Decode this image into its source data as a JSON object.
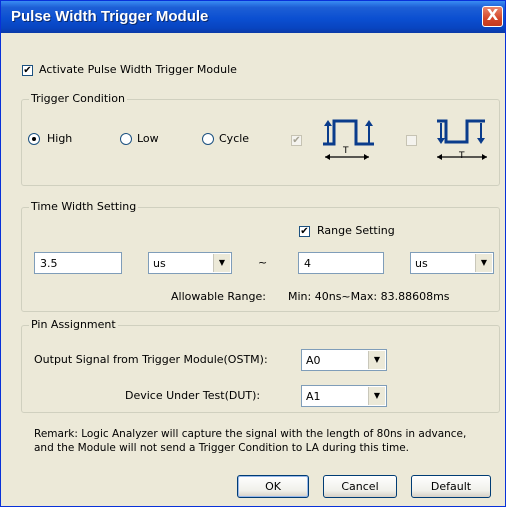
{
  "window": {
    "title": "Pulse Width Trigger Module",
    "close_label": "X"
  },
  "activate": {
    "label": "Activate Pulse Width Trigger Module",
    "checked": true
  },
  "trigger_condition": {
    "title": "Trigger Condition",
    "options": [
      {
        "label": "High",
        "selected": true
      },
      {
        "label": "Low",
        "selected": false
      },
      {
        "label": "Cycle",
        "selected": false
      }
    ],
    "pulse_high": {
      "checked": true,
      "enabled": false,
      "width_label": "T",
      "icon": "positive-pulse-icon"
    },
    "pulse_low": {
      "checked": false,
      "enabled": false,
      "width_label": "T",
      "icon": "negative-pulse-icon"
    }
  },
  "time_width": {
    "title": "Time Width Setting",
    "range_setting": {
      "label": "Range Setting",
      "checked": true
    },
    "min_value": "3.5",
    "min_unit": "us",
    "tilde": "~",
    "max_value": "4",
    "max_unit": "us",
    "allowable_label": "Allowable Range:",
    "allowable_value": "Min: 40ns~Max: 83.88608ms"
  },
  "pin_assignment": {
    "title": "Pin Assignment",
    "ostm_label": "Output Signal from Trigger Module(OSTM):",
    "ostm_value": "A0",
    "dut_label": "Device Under Test(DUT):",
    "dut_value": "A1"
  },
  "remark": {
    "line1": "Remark: Logic Analyzer will capture the signal with the length of 80ns in advance,",
    "line2": "and the Module will not send a Trigger Condition to LA during this time."
  },
  "buttons": {
    "ok": "OK",
    "cancel": "Cancel",
    "default": "Default"
  },
  "colors": {
    "titlebar": "#0b4fd1",
    "dialog_bg": "#ece9d8",
    "input_border": "#7f9db9"
  }
}
